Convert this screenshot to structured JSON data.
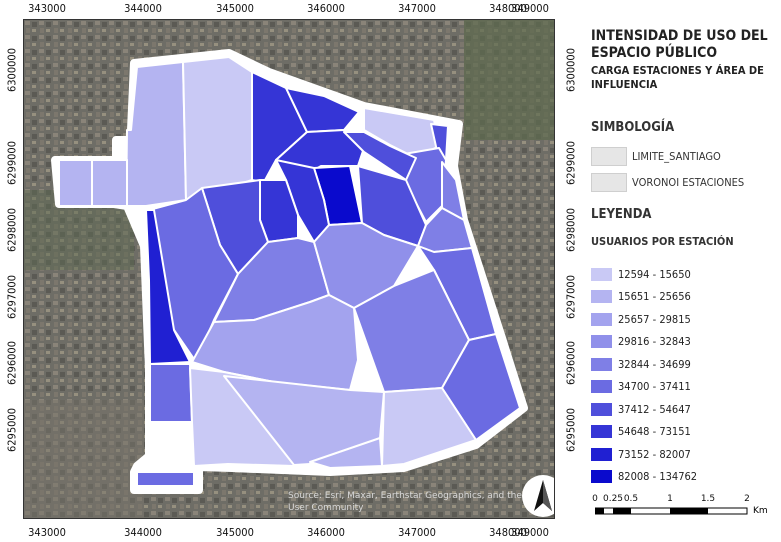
{
  "title": "INTENSIDAD DE USO DEL ESPACIO PÚBLICO",
  "subtitle": "CARGA ESTACIONES Y ÁREA DE INFLUENCIA",
  "symbology": {
    "heading": "SIMBOLOGÍA",
    "items": [
      {
        "label": "LIMITE_SANTIAGO"
      },
      {
        "label": "VORONOI ESTACIONES"
      }
    ]
  },
  "legend": {
    "heading": "LEYENDA",
    "subheading": "USUARIOS POR ESTACIÓN",
    "classes": [
      {
        "label": "12594 - 15650",
        "color": "#c9c9f5"
      },
      {
        "label": "15651 - 25656",
        "color": "#b4b4f1"
      },
      {
        "label": "25657 - 29815",
        "color": "#a3a3ee"
      },
      {
        "label": "29816 - 32843",
        "color": "#9090ea"
      },
      {
        "label": "32844 - 34699",
        "color": "#7f7fe6"
      },
      {
        "label": "34700 - 37411",
        "color": "#6b6be2"
      },
      {
        "label": "37412 - 54647",
        "color": "#4f4fdb"
      },
      {
        "label": "54648 - 73151",
        "color": "#3535d6"
      },
      {
        "label": "73152 - 82007",
        "color": "#2020d2"
      },
      {
        "label": "82008 - 134762",
        "color": "#0a0acd"
      }
    ]
  },
  "axes": {
    "x_ticks": [
      "343000",
      "344000",
      "345000",
      "346000",
      "347000",
      "348000",
      "349000"
    ],
    "y_ticks": [
      "6300000",
      "6299000",
      "6298000",
      "6297000",
      "6296000",
      "6295000"
    ]
  },
  "attribution": "Source: Esri, Maxar, Earthstar Geographics, and the GIS User Community",
  "north_arrow": {
    "icon": "north-arrow-icon"
  },
  "scale_bar": {
    "labels": [
      "0",
      "0.25",
      "0.5",
      "1",
      "1.5",
      "2"
    ],
    "unit": "Km"
  },
  "map_colors": {
    "boundary": "#ffffff",
    "voronoi_edge": "#ffffff"
  }
}
